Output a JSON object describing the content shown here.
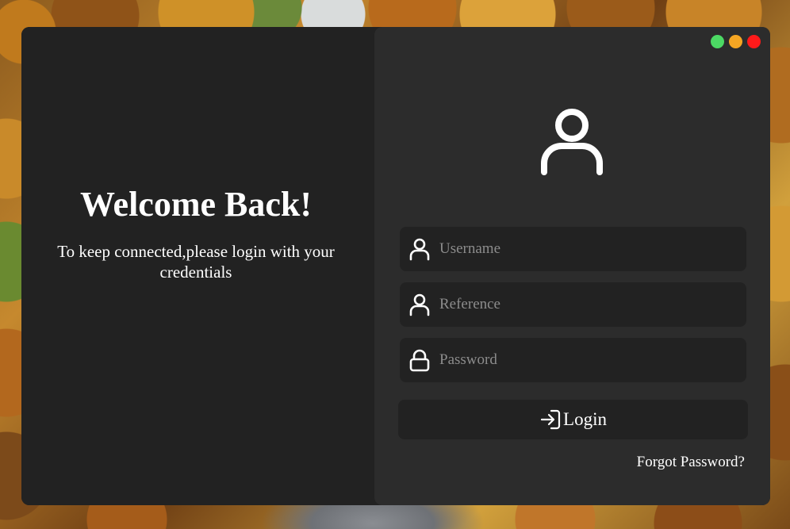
{
  "window": {
    "controls": [
      {
        "name": "maximize",
        "color": "#4cd964"
      },
      {
        "name": "minimize",
        "color": "#f5a623"
      },
      {
        "name": "close",
        "color": "#ff1a1a"
      }
    ]
  },
  "left_panel": {
    "heading": "Welcome Back!",
    "subtitle": "To keep connected,please login with your credentials"
  },
  "form": {
    "avatar_icon": "user-icon",
    "username": {
      "placeholder": "Username",
      "value": "",
      "icon": "user-icon"
    },
    "reference": {
      "placeholder": "Reference",
      "value": "",
      "icon": "user-icon"
    },
    "password": {
      "placeholder": "Password",
      "value": "",
      "icon": "lock-icon"
    },
    "login_button": {
      "label": "Login",
      "icon": "login-icon"
    },
    "forgot_link": "Forgot Password?"
  },
  "colors": {
    "left_panel_bg": "#222222",
    "right_panel_bg": "#2c2c2c",
    "field_bg": "#222222",
    "text": "#ffffff",
    "placeholder": "#8c8c8c"
  }
}
